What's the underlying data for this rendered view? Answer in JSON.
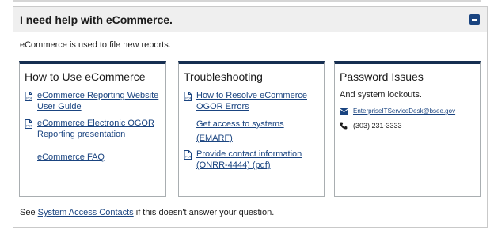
{
  "accordion": {
    "title": "I need help with eCommerce.",
    "intro": "eCommerce is used to file new reports."
  },
  "cards": {
    "howto": {
      "title": "How to Use eCommerce",
      "links": [
        "eCommerce Reporting Website User Guide",
        "eCommerce Electronic OGOR Reporting presentation",
        "eCommerce FAQ"
      ]
    },
    "trouble": {
      "title": "Troubleshooting",
      "links": [
        "How to Resolve eCommerce OGOR Errors",
        "Get access to systems (EMARF)",
        "Provide contact information (ONRR-4444) (pdf)"
      ]
    },
    "password": {
      "title": "Password Issues",
      "subtitle": "And system lockouts.",
      "email": "EnterpriseITServiceDesk@bsee.gov",
      "phone": "(303) 231-3333"
    }
  },
  "footer": {
    "prefix": "See ",
    "link": "System Access Contacts",
    "suffix": " if this doesn't answer your question."
  },
  "colors": {
    "link": "#1a4480",
    "card_border_top": "#162e51",
    "header_bg": "#efefef"
  },
  "icons": [
    "minus-square-icon",
    "pdf-file-icon",
    "envelope-icon",
    "phone-icon"
  ]
}
